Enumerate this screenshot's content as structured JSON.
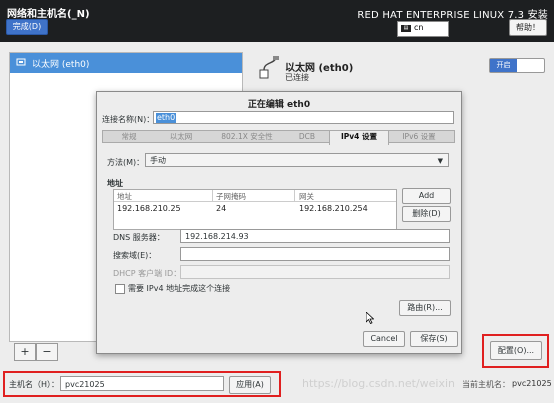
{
  "header": {
    "window_title": "网络和主机名(_N)",
    "done_label": "完成(D)",
    "product": "RED HAT ENTERPRISE LINUX 7.3 安装",
    "keyboard_layout": "cn",
    "keyboard_icon": "keyboard-icon",
    "help_label": "帮助！"
  },
  "device_list": {
    "items": [
      {
        "label": "以太网 (eth0)",
        "icon": "ethernet-icon",
        "selected": true
      }
    ],
    "add_label": "+",
    "remove_label": "−"
  },
  "connection": {
    "name": "以太网 (eth0)",
    "status": "已连接",
    "toggle_label": "开启",
    "toggle_state": "on",
    "configure_label": "配置(O)..."
  },
  "hostname": {
    "label": "主机名（H）：",
    "value": "pvc21025",
    "apply_label": "应用(A)",
    "current_label": "当前主机名：",
    "current_value": "pvc21025"
  },
  "watermark": "https://blog.csdn.net/weixin",
  "dialog": {
    "title": "正在编辑 eth0",
    "connection_name_label": "连接名称(N)：",
    "connection_name_value": "eth0",
    "tabs": [
      {
        "label": "常规",
        "active": false
      },
      {
        "label": "以太网",
        "active": false
      },
      {
        "label": "802.1X 安全性",
        "active": false
      },
      {
        "label": "DCB",
        "active": false
      },
      {
        "label": "IPv4 设置",
        "active": true
      },
      {
        "label": "IPv6 设置",
        "active": false
      }
    ],
    "method_label": "方法(M)：",
    "method_value": "手动",
    "addresses_label": "地址",
    "address_columns": [
      "地址",
      "子网掩码",
      "网关"
    ],
    "address_rows": [
      [
        "192.168.210.25",
        "24",
        "192.168.210.254"
      ]
    ],
    "add_label": "Add",
    "delete_label": "删除(D)",
    "dns_label": "DNS 服务器：",
    "dns_value": "192.168.214.93",
    "search_label": "搜索域(E)：",
    "search_value": "",
    "dhcp_label": "DHCP 客户端 ID：",
    "dhcp_value": "",
    "require_ipv4_label": "需要 IPv4 地址完成这个连接",
    "require_ipv4_checked": false,
    "routes_label": "路由(R)...",
    "cancel_label": "Cancel",
    "save_label": "保存(S)"
  },
  "colors": {
    "accent": "#3f73c9",
    "selection": "#4a90d9",
    "topbar": "#1d1f21",
    "highlight_box": "#e02020"
  }
}
